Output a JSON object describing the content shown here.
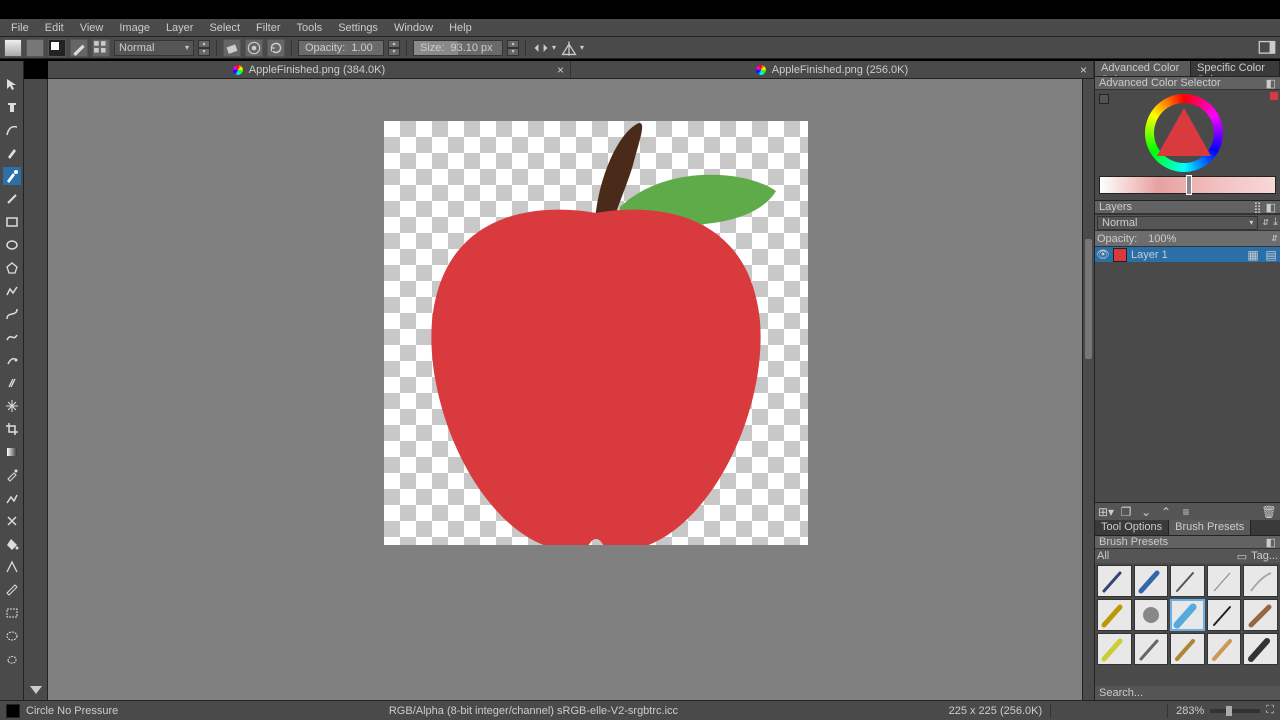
{
  "menu": {
    "items": [
      "File",
      "Edit",
      "View",
      "Image",
      "Layer",
      "Select",
      "Filter",
      "Tools",
      "Settings",
      "Window",
      "Help"
    ]
  },
  "toolbar": {
    "blend_mode": "Normal",
    "opacity_label": "Opacity:",
    "opacity_value": "1.00",
    "size_label": "Size:",
    "size_value": "93.10 px"
  },
  "documents": [
    {
      "name": "AppleFinished.png",
      "size": "(384.0K)"
    },
    {
      "name": "AppleFinished.png",
      "size": "(256.0K)"
    }
  ],
  "right": {
    "selector_tabs": [
      "Advanced Color Selector",
      "Specific Color Selector"
    ],
    "selector_header": "Advanced Color Selector",
    "layers": {
      "title": "Layers",
      "blend_mode": "Normal",
      "opacity_label": "Opacity:",
      "opacity_value": "100%",
      "items": [
        {
          "name": "Layer 1"
        }
      ]
    },
    "brush_tabs": [
      "Tool Options",
      "Brush Presets"
    ],
    "brush_header": "Brush Presets",
    "brush_filter_all": "All",
    "brush_tag": "Tag...",
    "brush_search": "Search..."
  },
  "status": {
    "brush_name": "Circle No Pressure",
    "color_info": "RGB/Alpha (8-bit integer/channel)  sRGB-elle-V2-srgbtrc.icc",
    "dims": "225 x 225 (256.0K)",
    "zoom": "283%"
  }
}
